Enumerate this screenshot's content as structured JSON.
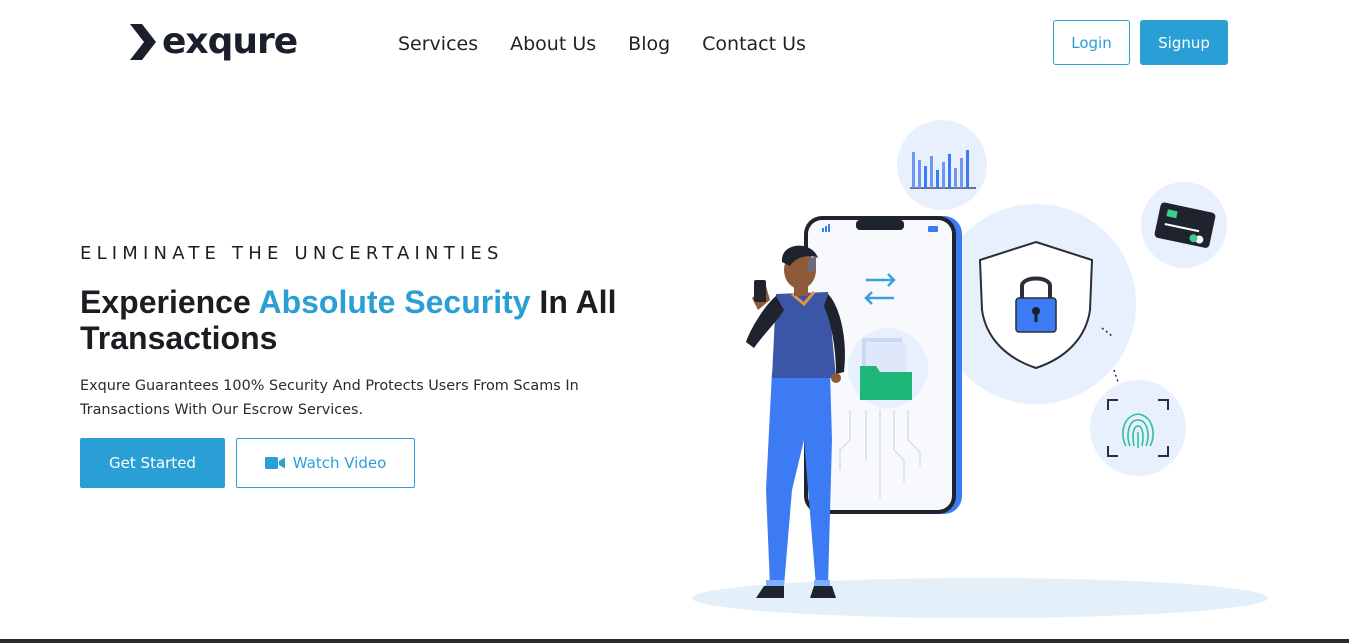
{
  "brand": {
    "name": "exqure"
  },
  "nav": {
    "items": [
      {
        "label": "Services"
      },
      {
        "label": "About Us"
      },
      {
        "label": "Blog"
      },
      {
        "label": "Contact Us"
      }
    ]
  },
  "auth": {
    "login_label": "Login",
    "signup_label": "Signup"
  },
  "hero": {
    "eyebrow": "ELIMINATE THE UNCERTAINTIES",
    "headline_part1": "Experience ",
    "headline_accent": "Absolute Security",
    "headline_part2": " In All Transactions",
    "description": "Exqure Guarantees 100% Security And Protects Users From Scams In Transactions With Our Escrow Services.",
    "primary_cta": "Get Started",
    "secondary_cta": "Watch Video"
  },
  "colors": {
    "accent": "#2a9fd6",
    "dark": "#1c1d22",
    "illustration_blue": "#3d7bf5",
    "illustration_light": "#e6effd"
  },
  "icons": {
    "logo": "chevron-right-icon",
    "video": "video-camera-icon",
    "shield": "shield-lock-icon",
    "chart": "bar-chart-icon",
    "card": "credit-card-icon",
    "fingerprint": "fingerprint-icon",
    "sync": "sync-arrows-icon",
    "folder": "folder-icon"
  }
}
